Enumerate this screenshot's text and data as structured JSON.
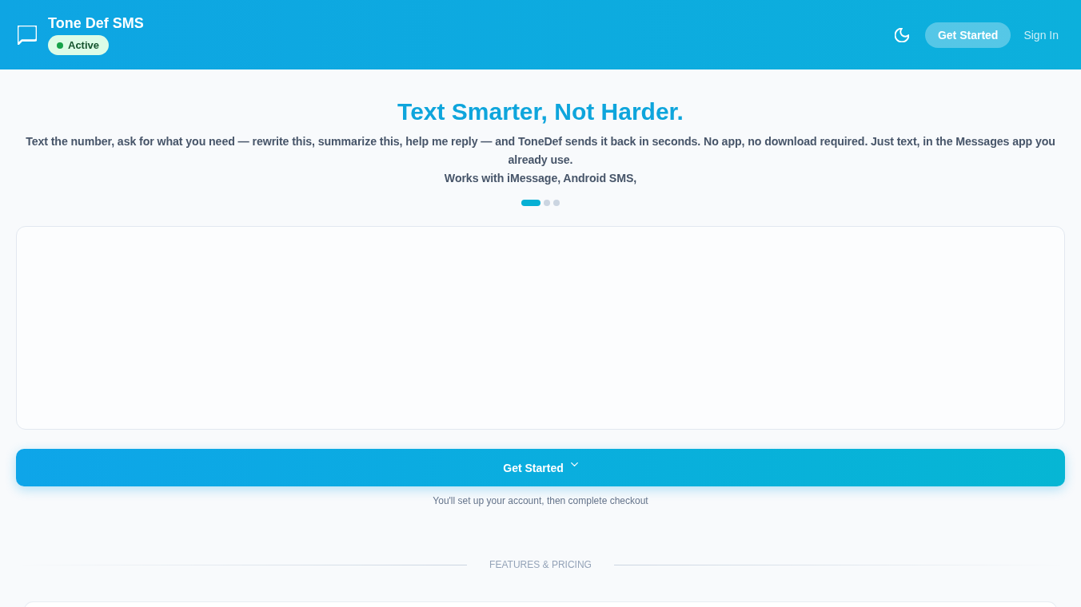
{
  "header": {
    "title": "Tone Def SMS",
    "status": {
      "label": "Active",
      "kind": "active"
    },
    "actions": [
      {
        "label": "Get Started",
        "kind": "pill"
      },
      {
        "label": "Sign In",
        "kind": "link"
      }
    ]
  },
  "hero": {
    "title": "Text Smarter, Not Harder.",
    "description": "Text the number, ask for what you need — rewrite this, summarize this, help me reply — and ToneDef sends it back in seconds. No app, no download required. Just text, in the Messages app you already use.",
    "tagline": "Works with iMessage, Android SMS,",
    "carousel": [
      {
        "selected": true
      },
      {
        "selected": false
      },
      {
        "selected": false
      }
    ]
  },
  "cta": {
    "label": "Get Started",
    "note": "You'll set up your account, then complete checkout"
  },
  "section_divider": {
    "label": "FEATURES & PRICING"
  }
}
